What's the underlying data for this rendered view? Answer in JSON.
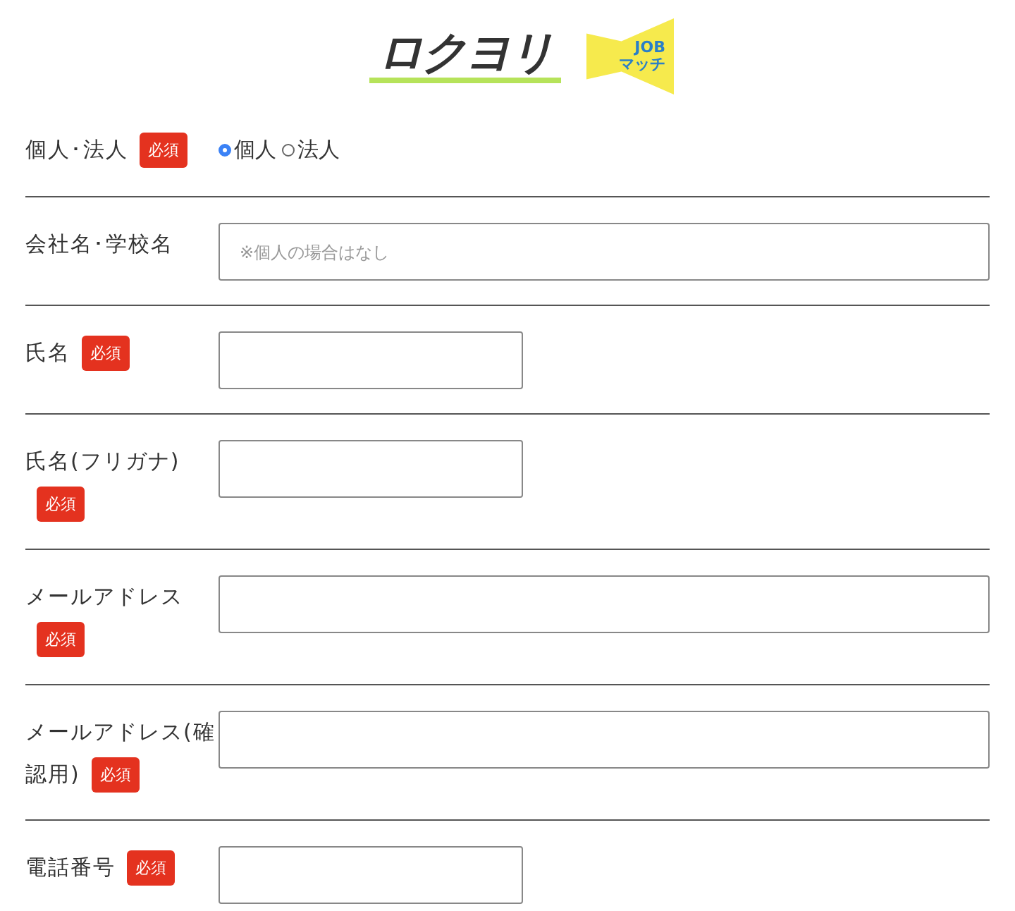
{
  "logo": {
    "main": "ロクヨリ",
    "sub_top": "JOB",
    "sub_bottom": "マッチ"
  },
  "rows": [
    {
      "kind": "radio",
      "label": [
        "個人･法人"
      ],
      "badge": "必須",
      "options": [
        {
          "label": "個人",
          "selected": true
        },
        {
          "label": "法人",
          "selected": false
        }
      ]
    },
    {
      "kind": "wide",
      "label": [
        "会社名･学校名"
      ],
      "placeholder": "※個人の場合はなし"
    },
    {
      "kind": "short",
      "label": [
        "氏名"
      ],
      "badge": "必須"
    },
    {
      "kind": "short",
      "label": [
        "氏名(フリガナ)"
      ],
      "badge": "必須"
    },
    {
      "kind": "wide",
      "label": [
        "メールアドレス"
      ],
      "badge": "必須"
    },
    {
      "kind": "wide",
      "label": [
        "メールアドレス(確",
        "認用)"
      ],
      "badge": "必須"
    },
    {
      "kind": "short",
      "label": [
        "電話番号"
      ],
      "badge": "必須"
    }
  ]
}
